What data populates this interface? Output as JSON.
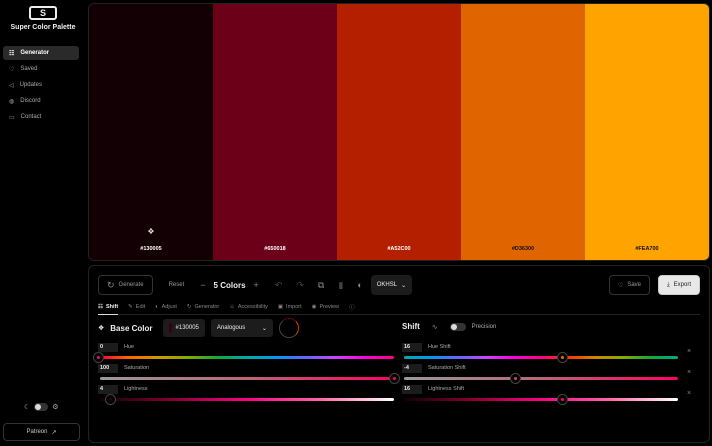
{
  "app": {
    "logo_letter": "S",
    "name": "Super Color Palette"
  },
  "sidebar": {
    "items": [
      {
        "label": "Generator",
        "icon": "sliders-icon"
      },
      {
        "label": "Saved",
        "icon": "heart-icon"
      },
      {
        "label": "Updates",
        "icon": "megaphone-icon"
      },
      {
        "label": "Discord",
        "icon": "discord-icon"
      },
      {
        "label": "Contact",
        "icon": "message-icon"
      }
    ],
    "patreon": "Patreon"
  },
  "palette": [
    {
      "hex": "#130005",
      "color": "#130005",
      "text": "#ffffff"
    },
    {
      "hex": "#650018",
      "color": "#6b0018",
      "text": "#ffffff"
    },
    {
      "hex": "#A52C00",
      "color": "#b41f00",
      "text": "#ffffff"
    },
    {
      "hex": "#D36300",
      "color": "#e06400",
      "text": "#111111"
    },
    {
      "hex": "#FEA700",
      "color": "#fea300",
      "text": "#111111"
    }
  ],
  "toolbar": {
    "generate": "Generate",
    "reset": "Reset",
    "count": "5 Colors",
    "mode": "OKHSL",
    "save": "Save",
    "export": "Export"
  },
  "tabs": [
    "Shift",
    "Edit",
    "Adjust",
    "Generator",
    "Accessibility",
    "Import",
    "Preview"
  ],
  "base": {
    "title": "Base Color",
    "hex": "#130005",
    "scheme": "Analogous"
  },
  "shift": {
    "title": "Shift",
    "precision": "Precision"
  },
  "sliders": [
    {
      "label": "Hue",
      "value": "0",
      "percent": 0
    },
    {
      "label": "Saturation",
      "value": "100",
      "percent": 100
    },
    {
      "label": "Lightness",
      "value": "4",
      "percent": 4
    }
  ],
  "shift_sliders": [
    {
      "label": "Hue Shift",
      "value": "16",
      "percent": 58
    },
    {
      "label": "Saturation Shift",
      "value": "-4",
      "percent": 41
    },
    {
      "label": "Lightness Shift",
      "value": "16",
      "percent": 58
    }
  ]
}
